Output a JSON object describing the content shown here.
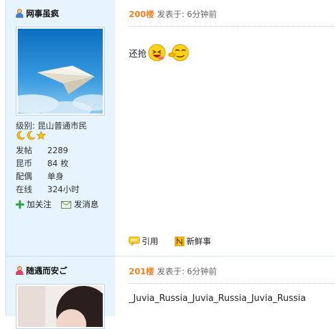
{
  "posts": [
    {
      "username": "网事虽疯",
      "level_label": "级别:",
      "level_value": "昆山普通市民",
      "stats": [
        {
          "key": "发帖",
          "value": "2289"
        },
        {
          "key": "昆币",
          "value": "84 枚"
        },
        {
          "key": "配偶",
          "value": "单身"
        },
        {
          "key": "在线",
          "value": "324小时"
        }
      ],
      "actions": {
        "follow": "加关注",
        "message": "发消息"
      },
      "floor": "200楼",
      "posted": "发表于: 6分钟前",
      "content": "还抢",
      "footer": {
        "quote": "引用",
        "fresh": "新鲜事"
      }
    },
    {
      "username": "随遇而安ご",
      "floor": "201楼",
      "posted": "发表于: 6分钟前",
      "content": "_Juvia_Russia_Juvia_Russia_Juvia_Russia"
    }
  ],
  "colors": {
    "floor": "#f0801f",
    "sidebar_bg": "#e7f3fd",
    "border": "#c7dcee"
  }
}
